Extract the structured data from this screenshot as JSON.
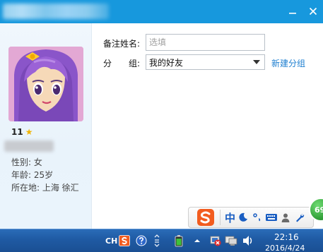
{
  "window": {
    "minimize_label": "—",
    "close_label": "✕"
  },
  "profile": {
    "level": "11",
    "level_icon": "star-icon",
    "gender": "性别: 女",
    "age": "年龄: 25岁",
    "location": "所在地: 上海  徐汇"
  },
  "form": {
    "remark_label": "备注姓名:",
    "remark_placeholder": "选填",
    "group_label_char1": "分",
    "group_label_char2": "组:",
    "group_value": "我的好友",
    "new_group_link": "新建分组"
  },
  "ime_toolbar": {
    "logo": "sogou-logo",
    "mode": "中",
    "icons": [
      "moon-icon",
      "punctuation-icon",
      "keyboard-icon",
      "user-icon",
      "wrench-icon"
    ]
  },
  "badge": {
    "value": "69"
  },
  "taskbar": {
    "lang": "CH",
    "time": "22:16",
    "date": "2016/4/24",
    "tray_icons": [
      "sogou-tray-icon",
      "help-icon",
      "tray-arrow-icon",
      "battery-icon",
      "up-arrow-icon",
      "network-blocked-icon",
      "display-icon",
      "volume-icon"
    ]
  },
  "colors": {
    "titlebar": "#1798dd",
    "link": "#1e7fd0",
    "taskbar": "#1f5aa3",
    "badge": "#2e9c36"
  }
}
